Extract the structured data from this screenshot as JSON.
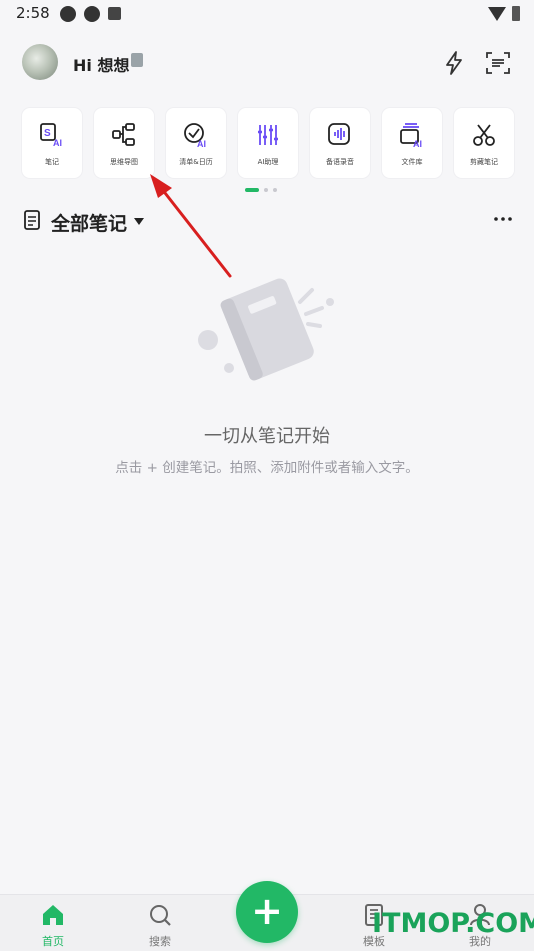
{
  "status_bar": {
    "time": "2:58"
  },
  "header": {
    "greeting": "Hi 想想"
  },
  "quick_tiles": [
    {
      "icon": "note-ai-icon",
      "label": "笔记"
    },
    {
      "icon": "mindmap-icon",
      "label": "思维导图"
    },
    {
      "icon": "checklist-ai-icon",
      "label": "清单&日历"
    },
    {
      "icon": "ai-assistant-icon",
      "label": "AI助理"
    },
    {
      "icon": "voice-record-icon",
      "label": "备语录音"
    },
    {
      "icon": "file-library-ai-icon",
      "label": "文件库"
    },
    {
      "icon": "scissors-icon",
      "label": "剪藏笔记"
    }
  ],
  "section": {
    "title": "全部笔记"
  },
  "empty_state": {
    "title": "一切从笔记开始",
    "description": "点击 + 创建笔记。拍照、添加附件或者输入文字。"
  },
  "bottom_nav": [
    {
      "icon": "home-icon",
      "label": "首页",
      "active": true
    },
    {
      "icon": "search-icon",
      "label": "搜索",
      "active": false
    },
    {
      "icon": "template-icon",
      "label": "模板",
      "active": false
    },
    {
      "icon": "profile-icon",
      "label": "我的",
      "active": false
    }
  ],
  "fab": {
    "label": "+"
  },
  "watermark": "ITMOP.COM",
  "colors": {
    "accent": "#22b866",
    "ai_purple": "#6a4cf5",
    "annotation_red": "#d81f1f"
  }
}
